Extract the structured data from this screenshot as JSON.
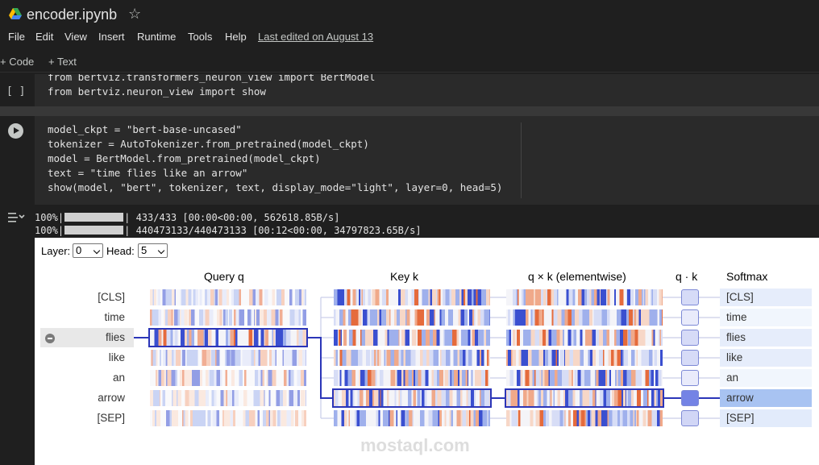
{
  "header": {
    "title": "encoder.ipynb",
    "star_icon": "☆",
    "menu": [
      "File",
      "Edit",
      "View",
      "Insert",
      "Runtime",
      "Tools",
      "Help"
    ],
    "last_edited": "Last edited on August 13"
  },
  "toolbar": {
    "code": "+ Code",
    "text": "+ Text"
  },
  "cell1": {
    "exec_label": "[ ]",
    "partial_line": "from bertviz.transformers_neuron_view import BertModel",
    "line2": "from bertviz.neuron_view import show"
  },
  "cell2": {
    "lines": [
      "model_ckpt = \"bert-base-uncased\"",
      "tokenizer = AutoTokenizer.from_pretrained(model_ckpt)",
      "model = BertModel.from_pretrained(model_ckpt)",
      "text = \"time flies like an arrow\"",
      "show(model, \"bert\", tokenizer, text, display_mode=\"light\", layer=0, head=5)"
    ]
  },
  "output": {
    "progress": [
      {
        "pct": "100%|",
        "rest": "| 433/433 [00:00<00:00, 562618.85B/s]"
      },
      {
        "pct": "100%|",
        "rest": "| 440473133/440473133 [00:12<00:00, 34797823.65B/s]"
      }
    ],
    "viz": {
      "layer_label": "Layer:",
      "layer_value": "0",
      "head_label": "Head:",
      "head_value": "5",
      "columns": [
        "Query q",
        "Key k",
        "q × k (elementwise)",
        "q · k",
        "Softmax"
      ],
      "tokens": [
        "[CLS]",
        "time",
        "flies",
        "like",
        "an",
        "arrow",
        "[SEP]"
      ],
      "selected_query": "flies",
      "selected_key": "arrow",
      "softmax_weights": [
        0.22,
        0.12,
        0.22,
        0.22,
        0.12,
        0.75,
        0.25
      ]
    }
  },
  "watermark": "mostaql.com"
}
